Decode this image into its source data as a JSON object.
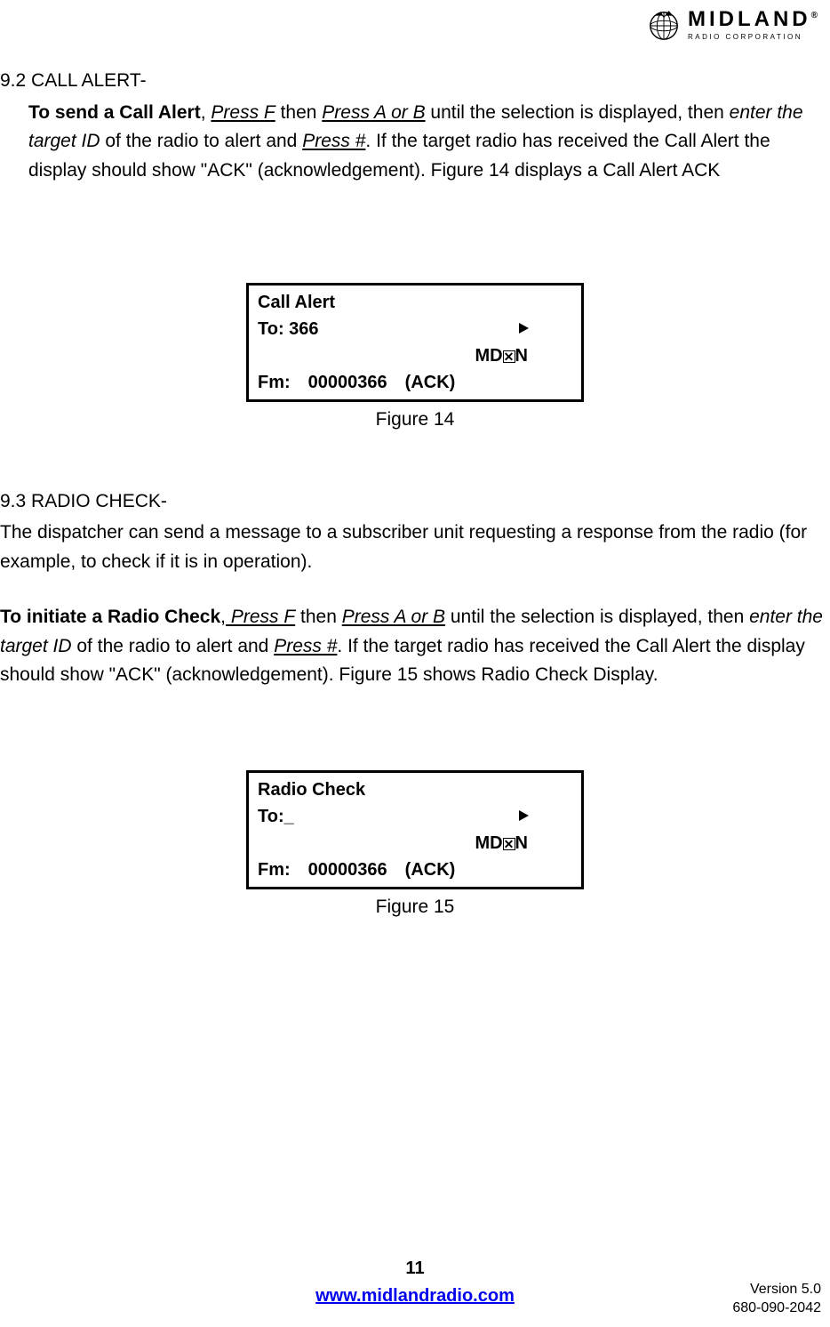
{
  "logo": {
    "brand": "MIDLAND",
    "subtitle": "RADIO CORPORATION"
  },
  "section92": {
    "heading": "9.2 CALL ALERT-",
    "lead_bold": "To send a Call Alert",
    "text1": ", ",
    "press_f": "Press F",
    "text2": " then ",
    "press_ab": "Press A or B",
    "text3": " until the selection is displayed, then ",
    "enter_id": "enter the target ID",
    "text4": " of the radio to alert and ",
    "press_hash": "Press #",
    "text5": ". If the target radio has received the Call Alert the display should show \"ACK\" (acknowledgement). Figure 14 displays a Call Alert ACK"
  },
  "figure14": {
    "title": "Call Alert",
    "to_label": "To: 366",
    "md_prefix": "MD",
    "md_suffix": "N",
    "fm_label": "Fm:",
    "fm_id": "00000366",
    "fm_ack": "(ACK)",
    "caption": "Figure 14"
  },
  "section93": {
    "heading": "9.3 RADIO CHECK-",
    "intro": "The dispatcher can send a message to a subscriber unit requesting a response from the radio (for example, to check if it is in operation).",
    "lead_bold": "To initiate a Radio Check",
    "text1": ",",
    "press_f": " Press F",
    "text2": " then ",
    "press_ab": "Press A or B",
    "text3": " until the selection is displayed, then ",
    "enter_id": "enter the target ID",
    "text4": " of the radio to alert and ",
    "press_hash": "Press #",
    "text5": ". If the target radio has received the Call Alert the display should show \"ACK\" (acknowledgement). Figure 15 shows Radio Check Display."
  },
  "figure15": {
    "title": "Radio Check",
    "to_label": "To:_",
    "md_prefix": "MD",
    "md_suffix": "N",
    "fm_label": "Fm:",
    "fm_id": "00000366",
    "fm_ack": "(ACK)",
    "caption": "Figure 15"
  },
  "footer": {
    "page": "11",
    "url": "www.midlandradio.com",
    "version": "Version 5.0",
    "docnum": "680-090-2042"
  }
}
